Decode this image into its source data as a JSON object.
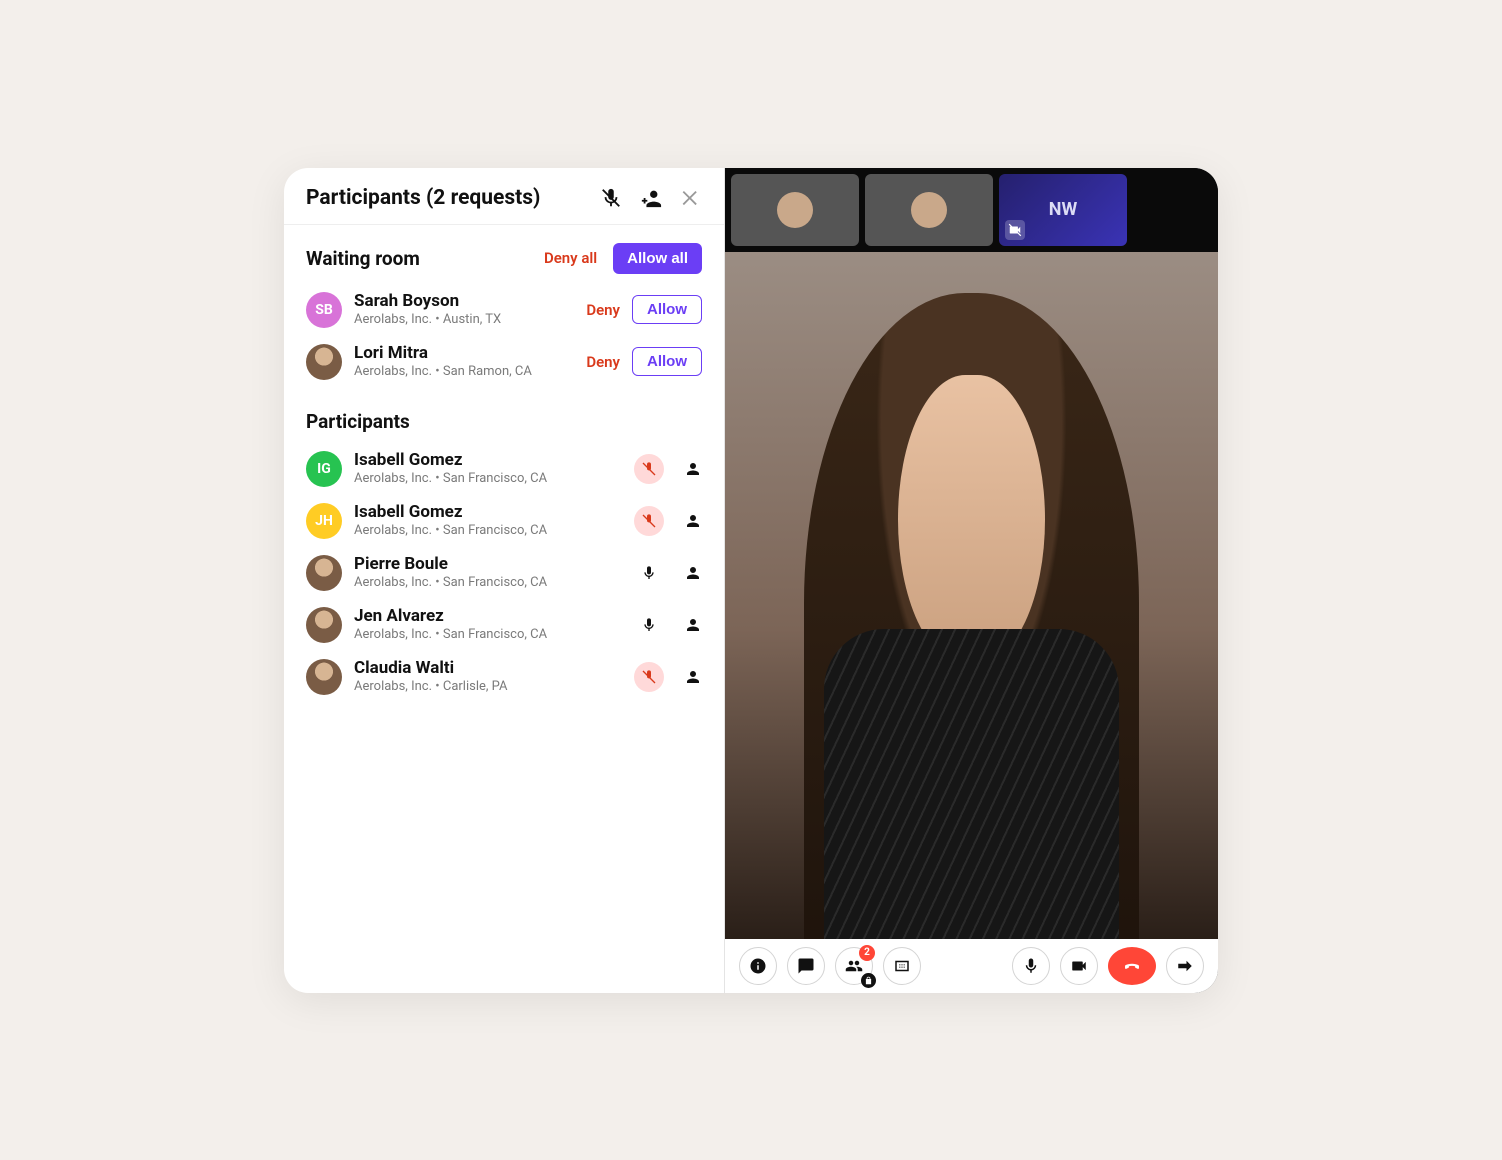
{
  "header": {
    "title": "Participants (2 requests)"
  },
  "waiting": {
    "title": "Waiting room",
    "deny_all": "Deny all",
    "allow_all": "Allow all",
    "deny": "Deny",
    "allow": "Allow",
    "items": [
      {
        "name": "Sarah Boyson",
        "sub": "Aerolabs, Inc.  •  Austin, TX",
        "initials": "SB",
        "avatar_bg": "#d873d8",
        "avatar_type": "initials"
      },
      {
        "name": "Lori Mitra",
        "sub": "Aerolabs, Inc.  •  San Ramon, CA",
        "avatar_type": "photo"
      }
    ]
  },
  "participants": {
    "title": "Participants",
    "items": [
      {
        "name": "Isabell Gomez",
        "sub": "Aerolabs, Inc.  •  San Francisco, CA",
        "initials": "IG",
        "avatar_bg": "#27c351",
        "avatar_type": "initials",
        "mic": "muted"
      },
      {
        "name": "Isabell Gomez",
        "sub": "Aerolabs, Inc.  •  San Francisco, CA",
        "initials": "JH",
        "avatar_bg": "#ffcc24",
        "avatar_type": "initials",
        "mic": "muted"
      },
      {
        "name": "Pierre Boule",
        "sub": "Aerolabs, Inc.  •  San Francisco, CA",
        "avatar_type": "photo",
        "mic": "on"
      },
      {
        "name": "Jen Alvarez",
        "sub": "Aerolabs, Inc.  •  San Francisco, CA",
        "avatar_type": "photo",
        "mic": "on"
      },
      {
        "name": "Claudia Walti",
        "sub": "Aerolabs, Inc.  •  Carlisle, PA",
        "avatar_type": "photo",
        "mic": "muted"
      }
    ]
  },
  "thumbs": {
    "nw_initials": "NW"
  },
  "toolbar": {
    "participants_badge": "2"
  }
}
